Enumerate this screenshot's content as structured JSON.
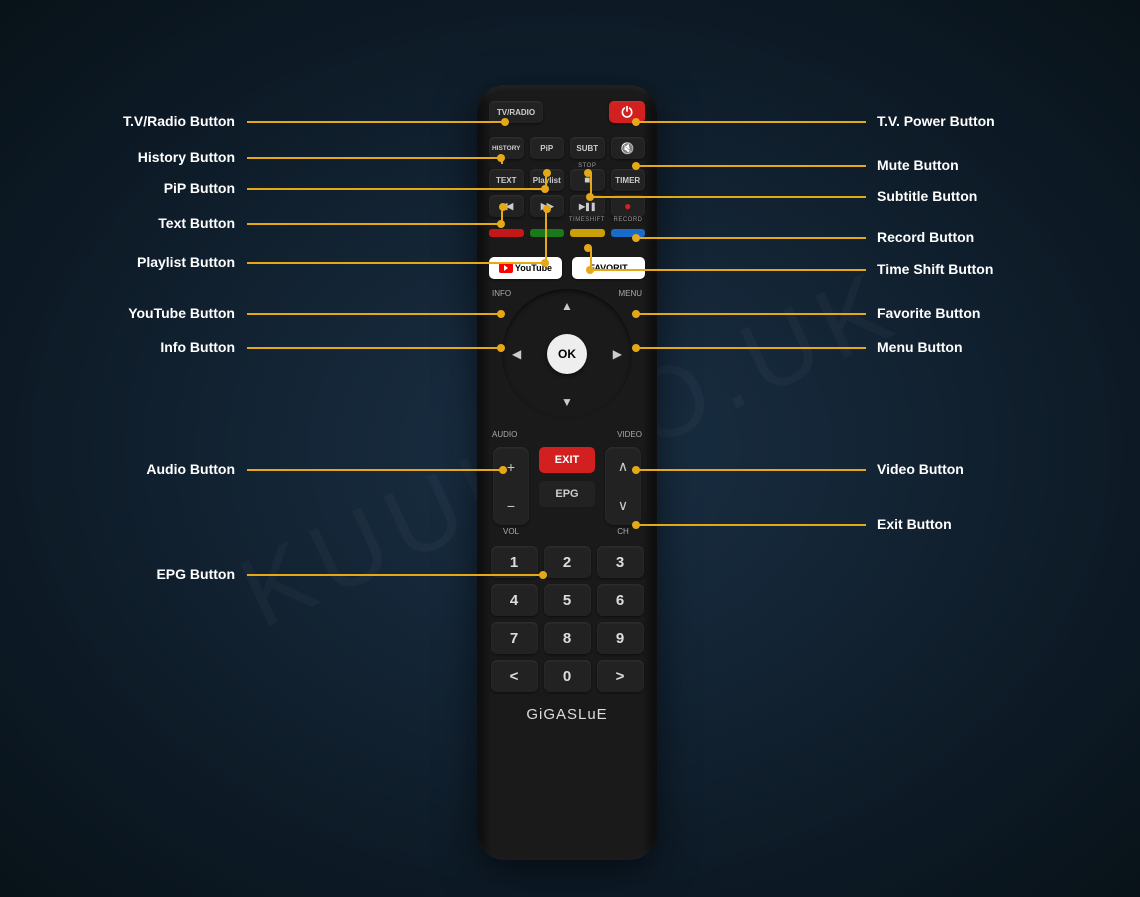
{
  "watermark": "KUUL.CO.UK",
  "brand": "GiGASLuE",
  "labels": {
    "left": {
      "tvradio": "T.V/Radio Button",
      "history": "History Button",
      "pip": "PiP Button",
      "text": "Text Button",
      "playlist": "Playlist Button",
      "youtube": "YouTube Button",
      "info": "Info Button",
      "audio": "Audio Button",
      "epg": "EPG Button"
    },
    "right": {
      "power": "T.V. Power Button",
      "mute": "Mute Button",
      "subtitle": "Subtitle Button",
      "record": "Record Button",
      "timeshift": "Time Shift Button",
      "favorite": "Favorite Button",
      "menu": "Menu Button",
      "video": "Video Button",
      "exit": "Exit Button"
    }
  },
  "buttons": {
    "tvradio": "TV/RADIO",
    "history": "HISTORY",
    "pip": "PiP",
    "subt": "SUBT",
    "text": "TEXT",
    "playlist": "Playlist",
    "stop_label": "STOP",
    "timer": "TIMER",
    "timeshift_label": "TIMESHIFT",
    "record_label": "RECORD",
    "youtube": "YouTube",
    "favorit": "FAVORIT",
    "info": "INFO",
    "menu": "MENU",
    "audio": "AUDIO",
    "video": "VIDEO",
    "ok": "OK",
    "exit": "EXIT",
    "epg": "EPG",
    "vol": "VOL",
    "ch": "CH"
  },
  "numpad": [
    "1",
    "2",
    "3",
    "4",
    "5",
    "6",
    "7",
    "8",
    "9",
    "<",
    "0",
    ">"
  ]
}
